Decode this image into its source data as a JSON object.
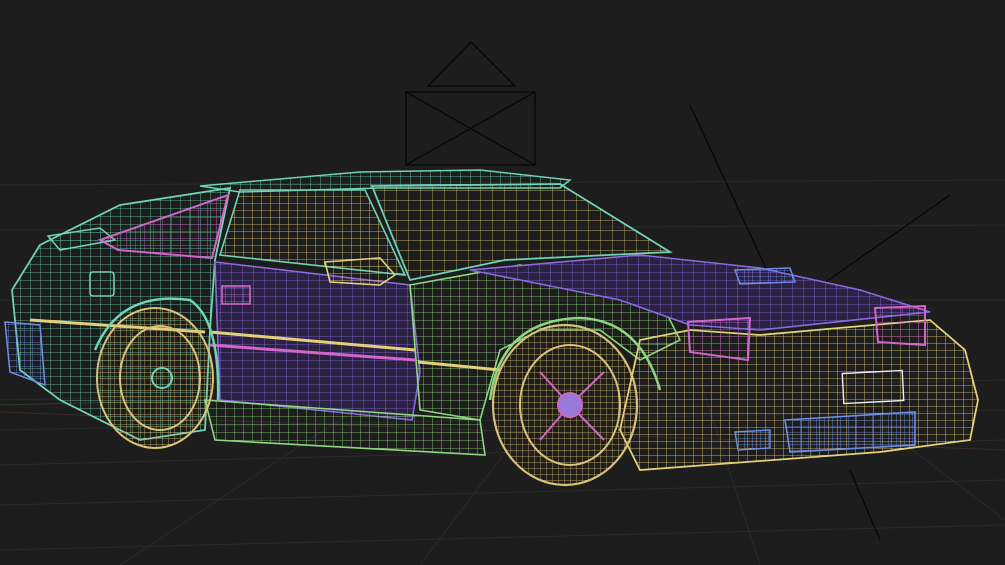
{
  "viewport": {
    "background": "#1d1d1d",
    "grid_color": "#2a2a2a"
  },
  "model": {
    "icon": "wireframe-sports-car",
    "palette": {
      "body_teal": "#6fd3b4",
      "body_yellow": "#e3d07a",
      "body_purple": "#7a5ad0",
      "accent_magenta": "#d066c8",
      "accent_blue": "#6f8ee6",
      "wheel_gold": "#d8c178"
    }
  },
  "camera_gizmo": {
    "icon": "camera-frustum-icon",
    "color": "#050505"
  }
}
